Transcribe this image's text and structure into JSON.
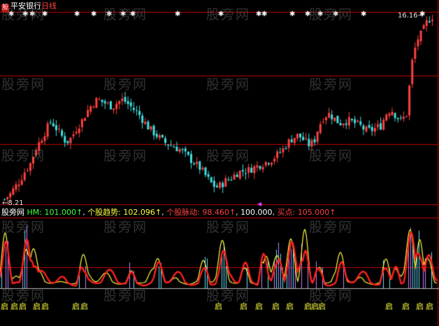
{
  "stock_name": "平安银行",
  "period": "日线",
  "logo_text": "股",
  "high_label": "16.16",
  "low_label": "8.21",
  "indicator": {
    "name": "股旁网",
    "hm_label": "HM:",
    "hm_value": "101.000",
    "trend_label": "个股趋势:",
    "trend_value": "102.096",
    "pulse_label": "个股脉动:",
    "pulse_value": "98.460",
    "ref_value": "100.000",
    "buy_label": "买点:",
    "buy_value": "105.000",
    "arrow": "↑"
  },
  "signal_text": "启",
  "watermark_text": "股旁网",
  "colors": {
    "up": "#ff4040",
    "down": "#40e0e0",
    "trend_line": "#ff2020",
    "hm_line": "#ffff40",
    "signal": "#ffff40",
    "frame": "#c00000",
    "hm_text": "#40ff40",
    "trend_text": "#ffff40",
    "pulse_text": "#ff4040",
    "buy_text": "#ff4040",
    "white": "#ffffff"
  },
  "chart_data": {
    "type": "candlestick",
    "price_range": [
      8.21,
      16.16
    ],
    "price_approx": [
      8.3,
      8.5,
      8.8,
      9.1,
      9.5,
      9.8,
      10.4,
      10.8,
      11.2,
      11.6,
      11.3,
      11.0,
      10.7,
      10.9,
      11.3,
      11.6,
      12.0,
      12.3,
      12.5,
      12.4,
      12.3,
      12.2,
      12.4,
      12.5,
      12.3,
      12.1,
      11.9,
      11.6,
      11.3,
      11.1,
      10.9,
      10.7,
      10.6,
      10.5,
      10.4,
      10.2,
      10.0,
      9.8,
      9.6,
      9.3,
      9.0,
      8.8,
      8.9,
      9.1,
      9.2,
      9.4,
      9.5,
      9.5,
      9.6,
      9.7,
      9.8,
      9.9,
      10.0,
      10.2,
      10.4,
      10.7,
      10.9,
      11.0,
      10.8,
      10.6,
      10.7,
      11.4,
      11.8,
      11.9,
      11.7,
      11.5,
      11.6,
      11.6,
      11.5,
      11.4,
      11.2,
      11.2,
      11.3,
      11.4,
      11.9,
      12.1,
      11.8,
      11.6,
      11.9,
      14.0,
      15.0,
      15.3,
      15.8,
      16.0
    ],
    "signal_positions_note": "yellow 启 buy signals along bottom of indicator pane",
    "indicator_values": {
      "HM": 101.0,
      "trend": 102.096,
      "pulse": 98.46,
      "ref": 100.0,
      "buy": 105.0
    }
  }
}
